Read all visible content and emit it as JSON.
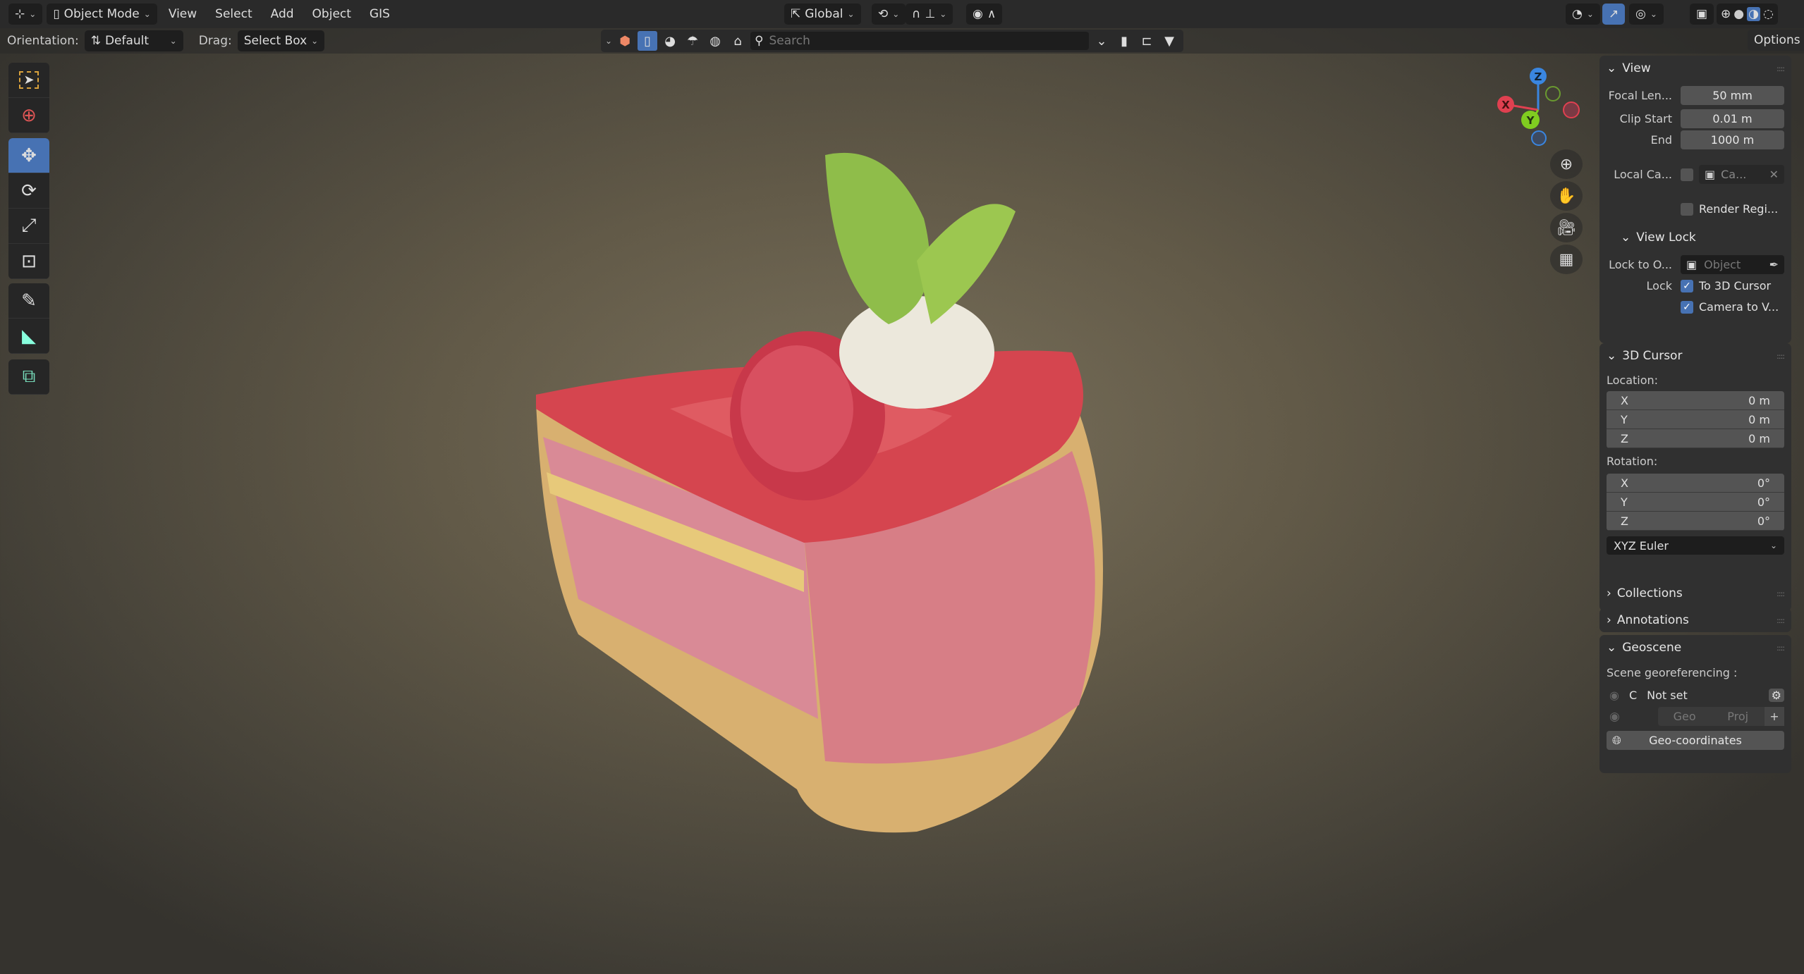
{
  "header": {
    "mode": "Object Mode",
    "menus": [
      "View",
      "Select",
      "Add",
      "Object",
      "GIS"
    ],
    "transform_orientation": "Global"
  },
  "tool_settings": {
    "orientation_label": "Orientation:",
    "orientation_value": "Default",
    "drag_label": "Drag:",
    "drag_value": "Select Box",
    "search_placeholder": "Search",
    "options": "Options"
  },
  "toolbar": [
    "select-box",
    "cursor",
    "move",
    "rotate",
    "scale",
    "transform",
    "annotate",
    "measure",
    "add-cube"
  ],
  "panel": {
    "view": {
      "title": "View",
      "focal_label": "Focal Len...",
      "focal": "50 mm",
      "clip_start_label": "Clip Start",
      "clip_start": "0.01 m",
      "end_label": "End",
      "end": "1000 m",
      "local_cam_label": "Local Ca...",
      "local_cam_value": "Ca...",
      "render_region": "Render Regi...",
      "view_lock": {
        "title": "View Lock",
        "lock_obj_label": "Lock to O...",
        "lock_obj_placeholder": "Object",
        "lock_label": "Lock",
        "to_cursor": "To 3D Cursor",
        "camera_to_view": "Camera to V..."
      }
    },
    "cursor": {
      "title": "3D Cursor",
      "location_label": "Location:",
      "location": [
        {
          "axis": "X",
          "value": "0 m"
        },
        {
          "axis": "Y",
          "value": "0 m"
        },
        {
          "axis": "Z",
          "value": "0 m"
        }
      ],
      "rotation_label": "Rotation:",
      "rotation": [
        {
          "axis": "X",
          "value": "0°"
        },
        {
          "axis": "Y",
          "value": "0°"
        },
        {
          "axis": "Z",
          "value": "0°"
        }
      ],
      "rotation_mode": "XYZ Euler"
    },
    "collections": "Collections",
    "annotations": "Annotations",
    "geoscene": {
      "title": "Geoscene",
      "label": "Scene georeferencing :",
      "crs_letter": "C",
      "crs_value": "Not set",
      "geo": "Geo",
      "proj": "Proj",
      "geo_coordinates": "Geo-coordinates"
    }
  },
  "gizmo": {
    "x": "X",
    "y": "Y",
    "z": "Z"
  }
}
